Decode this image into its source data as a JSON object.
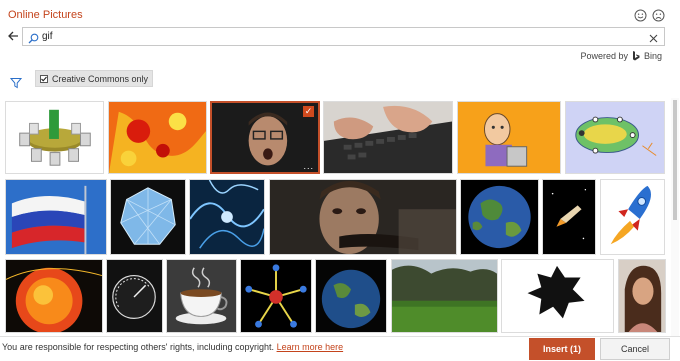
{
  "dialog": {
    "title": "Online Pictures"
  },
  "search": {
    "query": "gif"
  },
  "powered_by": {
    "label": "Powered by",
    "brand": "Bing"
  },
  "filters": {
    "creative_commons_label": "Creative Commons only",
    "creative_commons_checked": true
  },
  "results": [
    {
      "name": "3d-table-figures"
    },
    {
      "name": "orange-fractal"
    },
    {
      "name": "surprised-man",
      "selected": true
    },
    {
      "name": "typing-on-keyboard"
    },
    {
      "name": "cartoon-character-orange"
    },
    {
      "name": "fish-diagram"
    },
    {
      "name": "russian-flag"
    },
    {
      "name": "crystal-sphere"
    },
    {
      "name": "blue-fractal"
    },
    {
      "name": "man-close-up"
    },
    {
      "name": "earth-globe"
    },
    {
      "name": "space-shuttle"
    },
    {
      "name": "rocket-cartoon"
    },
    {
      "name": "sun-surface"
    },
    {
      "name": "speedometer"
    },
    {
      "name": "coffee-cup"
    },
    {
      "name": "molecule-structure"
    },
    {
      "name": "earth-dark"
    },
    {
      "name": "grass-field"
    },
    {
      "name": "koch-snowflake"
    },
    {
      "name": "woman-portrait"
    }
  ],
  "selection": {
    "check": "✓",
    "more": "..."
  },
  "footer": {
    "note": "You are responsible for respecting others' rights, including copyright.",
    "learn_more": "Learn more here",
    "insert_label": "Insert (1)",
    "cancel_label": "Cancel"
  },
  "colors": {
    "accent": "#c4502a",
    "title": "#c4441c",
    "filter_blue": "#2b6fc9"
  }
}
